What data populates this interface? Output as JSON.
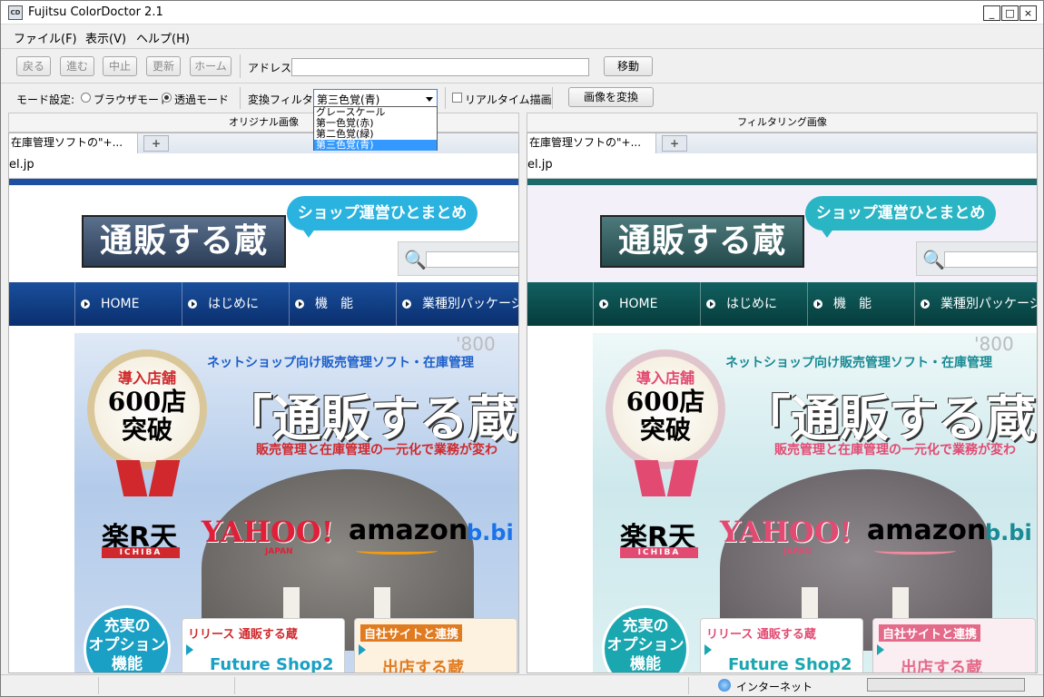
{
  "window": {
    "title": "Fujitsu ColorDoctor 2.1",
    "icon_text": "CD",
    "min": "_",
    "max": "□",
    "close": "×"
  },
  "menu": {
    "file": "ファイル(F)",
    "view": "表示(V)",
    "help": "ヘルプ(H)"
  },
  "toolbar": {
    "back": "戻る",
    "forward": "進む",
    "stop": "中止",
    "refresh": "更新",
    "home": "ホーム",
    "address_label": "アドレス:",
    "address_value": "",
    "go": "移動"
  },
  "options": {
    "mode_label": "モード設定:",
    "browser_mode": "ブラウザモード",
    "transparent_mode": "透過モード",
    "filter_label": "変換フィルタ:",
    "filter_selected": "第三色覚(青)",
    "filter_options": [
      "グレースケール",
      "第一色覚(赤)",
      "第二色覚(緑)",
      "第三色覚(青)"
    ],
    "realtime": "リアルタイム描画",
    "convert_button": "画像を変換"
  },
  "panes": {
    "original_header": "オリジナル画像",
    "filtered_header": "フィルタリング画像",
    "tab_label": "在庫管理ソフトの\"+...",
    "newtab": "+",
    "url_text": "el.jp"
  },
  "site": {
    "bubble": "ショップ運営ひとまとめ",
    "logo": "通販する蔵",
    "nav": [
      "HOME",
      "はじめに",
      "機　能",
      "業種別パッケージ"
    ],
    "hero_tag": "ネットショップ向け販売管理ソフト・在庫管理",
    "hero_title": "「通販する蔵",
    "hero_sub": "販売管理と在庫管理の一元化で業務が変わ",
    "medal_line1": "導入店舗",
    "medal_line2": "600店",
    "medal_line3": "突破",
    "rakuten": "楽R天",
    "rakuten_sub": "ICHIBA",
    "yahoo": "YAHOO!",
    "yahoo_sub": "JAPAN",
    "amazon": "amazon",
    "bi": "b.bi",
    "option_circle": "充実の\nオプション\n機能",
    "promo1_top": "リリース 通販する蔵",
    "promo1_bottom": "Future Shop2",
    "promo2_top": "自社サイトと連携",
    "promo2_bottom": "出店する蔵",
    "deco": "'800"
  },
  "status": {
    "zone": "インターネット"
  },
  "colors": {
    "original_nav": "#0b3a86",
    "filtered_nav": "#0a4a4a",
    "original_band": "#1f4fa0",
    "filtered_band": "#1a6a6a",
    "original_bubble": "#2bb3e0",
    "filtered_bubble": "#2ab5c5",
    "original_hero": "#bcd2ec",
    "filtered_hero": "#d8eef0",
    "original_tag": "#1c5fc9",
    "filtered_tag": "#1a8a94",
    "original_red": "#d0282c",
    "filtered_red": "#e34a72"
  }
}
